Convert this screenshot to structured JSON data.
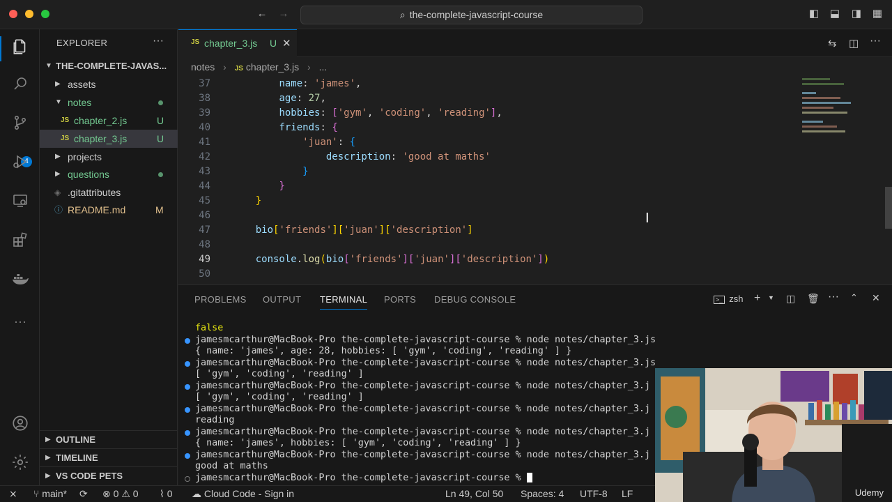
{
  "window": {
    "search_text": "the-complete-javascript-course"
  },
  "activity_bar": {
    "scm_badge": "4"
  },
  "sidebar": {
    "header": "EXPLORER",
    "root": "THE-COMPLETE-JAVAS...",
    "tree": [
      {
        "label": "assets",
        "status": ""
      },
      {
        "label": "notes",
        "status": ""
      },
      {
        "label": "chapter_2.js",
        "status": "U"
      },
      {
        "label": "chapter_3.js",
        "status": "U"
      },
      {
        "label": "projects",
        "status": ""
      },
      {
        "label": "questions",
        "status": ""
      },
      {
        "label": ".gitattributes",
        "status": ""
      },
      {
        "label": "README.md",
        "status": "M"
      }
    ],
    "sections": [
      "OUTLINE",
      "TIMELINE",
      "VS CODE PETS"
    ]
  },
  "editor": {
    "tab": {
      "icon": "JS",
      "label": "chapter_3.js",
      "status": "U"
    },
    "breadcrumb": [
      "notes",
      "chapter_3.js",
      "..."
    ],
    "line_numbers": [
      "37",
      "38",
      "39",
      "40",
      "41",
      "42",
      "43",
      "44",
      "45",
      "46",
      "47",
      "48",
      "49",
      "50"
    ]
  },
  "panel": {
    "tabs": [
      "PROBLEMS",
      "OUTPUT",
      "TERMINAL",
      "PORTS",
      "DEBUG CONSOLE"
    ],
    "active_tab": "TERMINAL",
    "shell": "zsh",
    "terminal_lines": [
      "false",
      "jamesmcarthur@MacBook-Pro the-complete-javascript-course % node notes/chapter_3.js",
      "{ name: 'james', age: 28, hobbies: [ 'gym', 'coding', 'reading' ] }",
      "jamesmcarthur@MacBook-Pro the-complete-javascript-course % node notes/chapter_3.js",
      "[ 'gym', 'coding', 'reading' ]",
      "jamesmcarthur@MacBook-Pro the-complete-javascript-course % node notes/chapter_3.j",
      "[ 'gym', 'coding', 'reading' ]",
      "jamesmcarthur@MacBook-Pro the-complete-javascript-course % node notes/chapter_3.j",
      "reading",
      "jamesmcarthur@MacBook-Pro the-complete-javascript-course % node notes/chapter_3.j",
      "{ name: 'james', hobbies: [ 'gym', 'coding', 'reading' ] }",
      "jamesmcarthur@MacBook-Pro the-complete-javascript-course % node notes/chapter_3.j",
      "good at maths",
      "jamesmcarthur@MacBook-Pro the-complete-javascript-course % "
    ]
  },
  "status_bar": {
    "branch": "main*",
    "errors": "0",
    "warnings": "0",
    "ports": "0",
    "cloud": "Cloud Code - Sign in",
    "position": "Ln 49, Col 50",
    "spaces": "Spaces: 4",
    "encoding": "UTF-8",
    "eol": "LF"
  },
  "webcam": {
    "watermark": "Udemy"
  },
  "colors": {
    "accent": "#0078d4",
    "badge": "#0078d4",
    "git_untracked": "#73c991",
    "git_modified": "#e2c08d"
  }
}
